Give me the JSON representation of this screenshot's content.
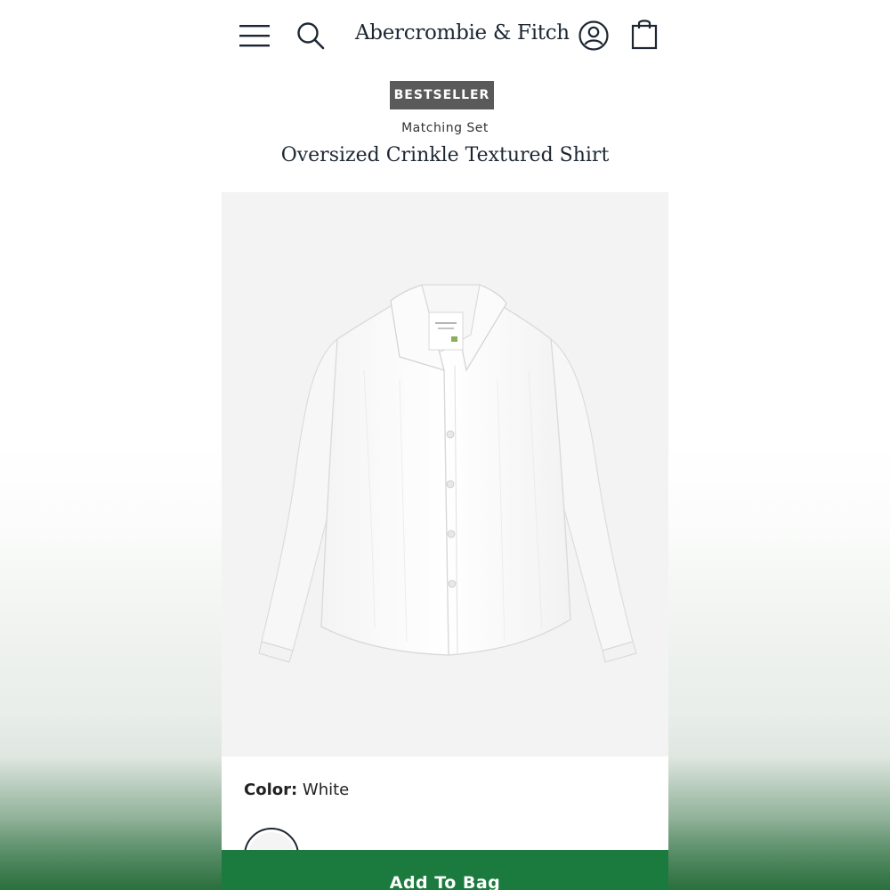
{
  "header": {
    "logo_text": "Abercrombie & Fitch",
    "icons": [
      "menu-icon",
      "search-icon",
      "account-icon",
      "shopping-bag-icon"
    ]
  },
  "product": {
    "badge": "BESTSELLER",
    "subtitle": "Matching Set",
    "title": "Oversized Crinkle Textured Shirt",
    "image_alt": "white shirt product photo"
  },
  "color": {
    "label": "Color:",
    "value": "White",
    "swatch_color": "#f4f4f4"
  },
  "cta": {
    "add_to_bag": "Add To Bag",
    "accent": "#1b7a3d"
  },
  "colors": {
    "badge_bg": "#5a5a5a",
    "text": "#1d2733"
  }
}
